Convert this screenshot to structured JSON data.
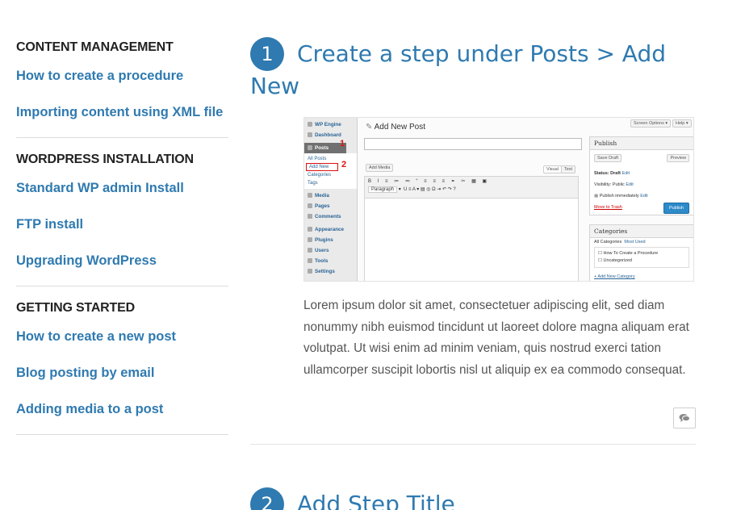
{
  "sidebar": {
    "sections": [
      {
        "heading": "CONTENT MANAGEMENT",
        "links": [
          "How to create a procedure",
          "Importing content using XML file"
        ]
      },
      {
        "heading": "WORDPRESS INSTALLATION",
        "links": [
          "Standard WP admin Install",
          "FTP install",
          "Upgrading WordPress"
        ]
      },
      {
        "heading": "GETTING STARTED",
        "links": [
          "How to create a new post",
          "Blog posting by email",
          "Adding media to a post"
        ]
      }
    ]
  },
  "step1": {
    "number": "1",
    "title": "Create a step under Posts > Add New",
    "body": "Lorem ipsum dolor sit amet, consectetuer adipiscing elit, sed diam nonummy nibh euismod tincidunt ut laoreet dolore magna aliquam erat volutpat. Ut wisi enim ad minim veniam, quis nostrud exerci tation ullamcorper suscipit lobortis nisl ut aliquip ex ea commodo consequat."
  },
  "step2": {
    "number": "2",
    "title": "Add Step Title"
  },
  "screenshot": {
    "menu": [
      "WP Engine",
      "Dashboard",
      "Posts",
      "Media",
      "Pages",
      "Comments",
      "Appearance",
      "Plugins",
      "Users",
      "Tools",
      "Settings"
    ],
    "posts_sub": [
      "All Posts",
      "Add New",
      "Categories",
      "Tags"
    ],
    "marker1": "1",
    "marker2": "2",
    "page_title": "Add New Post",
    "screen_options": "Screen Options ▾",
    "help": "Help ▾",
    "add_media": "Add Media",
    "tab_visual": "Visual",
    "tab_text": "Text",
    "paragraph": "Paragraph",
    "publish_head": "Publish",
    "save_draft": "Save Draft",
    "preview": "Preview",
    "status": "Status: Draft",
    "visibility": "Visibility: Public",
    "publish_immediately": "Publish immediately",
    "edit": "Edit",
    "move_to_trash": "Move to Trash",
    "publish": "Publish",
    "categories_head": "Categories",
    "all_categories": "All Categories",
    "most_used": "Most Used",
    "cat1": "How To Create a Procedure",
    "cat2": "Uncategorized",
    "add_new_category": "+ Add New Category"
  },
  "colors": {
    "link": "#2f7ab0",
    "accent": "#2f7ab0",
    "marker": "#dd1111"
  },
  "icons": {
    "comment": "comment-icon"
  }
}
